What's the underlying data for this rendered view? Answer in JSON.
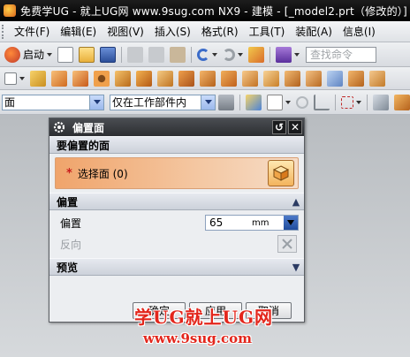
{
  "window": {
    "title": "免费学UG - 就上UG网 www.9sug.com   NX9 - 建模 - [_model2.prt（修改的）]"
  },
  "menu": {
    "items": [
      {
        "label": "文件",
        "key": "(F)"
      },
      {
        "label": "编辑",
        "key": "(E)"
      },
      {
        "label": "视图",
        "key": "(V)"
      },
      {
        "label": "插入",
        "key": "(S)"
      },
      {
        "label": "格式",
        "key": "(R)"
      },
      {
        "label": "工具",
        "key": "(T)"
      },
      {
        "label": "装配",
        "key": "(A)"
      },
      {
        "label": "信息",
        "key": "(I)"
      }
    ]
  },
  "toolbar": {
    "start_label": "启动",
    "search_placeholder": "查找命令",
    "selection_filter": "面",
    "selection_scope": "仅在工作部件内"
  },
  "dialog": {
    "title": "偏置面",
    "section_faces": "要偏置的面",
    "select_face_label": "选择面 (0)",
    "section_offset": "偏置",
    "offset_label": "偏置",
    "offset_value": "65",
    "offset_unit": "mm",
    "reverse_label": "反向",
    "section_preview": "预览",
    "ok_label": "确定",
    "apply_label": "应用",
    "cancel_label": "取消"
  },
  "watermark": {
    "line1": "学UG就上UG网",
    "line2": "www.9sug.com"
  },
  "colors": {
    "select_highlight": "#f0a46b",
    "title_bar": "#000000",
    "watermark": "#e3261c"
  }
}
